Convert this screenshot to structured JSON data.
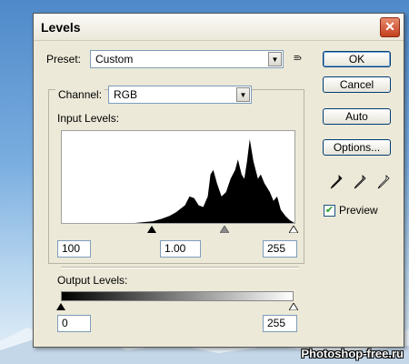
{
  "dialog": {
    "title": "Levels"
  },
  "preset": {
    "label": "Preset:",
    "value": "Custom"
  },
  "channel": {
    "label": "Channel:",
    "value": "RGB"
  },
  "input_levels": {
    "label": "Input Levels:",
    "black": "100",
    "gamma": "1.00",
    "white": "255"
  },
  "output_levels": {
    "label": "Output Levels:",
    "black": "0",
    "white": "255"
  },
  "buttons": {
    "ok": "OK",
    "cancel": "Cancel",
    "auto": "Auto",
    "options": "Options..."
  },
  "preview": {
    "label": "Preview",
    "checked": true
  },
  "watermark": "Photoshop-free.ru",
  "chart_data": {
    "type": "area",
    "title": "",
    "xlim": [
      0,
      255
    ],
    "ylim": [
      0,
      1
    ],
    "series": [
      {
        "x": [
          0,
          40,
          80,
          100,
          110,
          118,
          125,
          135,
          140,
          145,
          150,
          155,
          160,
          163,
          166,
          170,
          175,
          180,
          185,
          190,
          193,
          197,
          200,
          203,
          206,
          210,
          215,
          218,
          222,
          228,
          232,
          236,
          240,
          245,
          250,
          255
        ],
        "values": [
          0,
          0,
          0,
          0.02,
          0.05,
          0.08,
          0.12,
          0.2,
          0.3,
          0.28,
          0.2,
          0.18,
          0.3,
          0.55,
          0.6,
          0.45,
          0.3,
          0.35,
          0.5,
          0.6,
          0.72,
          0.55,
          0.5,
          0.7,
          0.95,
          0.7,
          0.5,
          0.55,
          0.45,
          0.35,
          0.25,
          0.3,
          0.15,
          0.08,
          0.03,
          0
        ]
      }
    ]
  }
}
